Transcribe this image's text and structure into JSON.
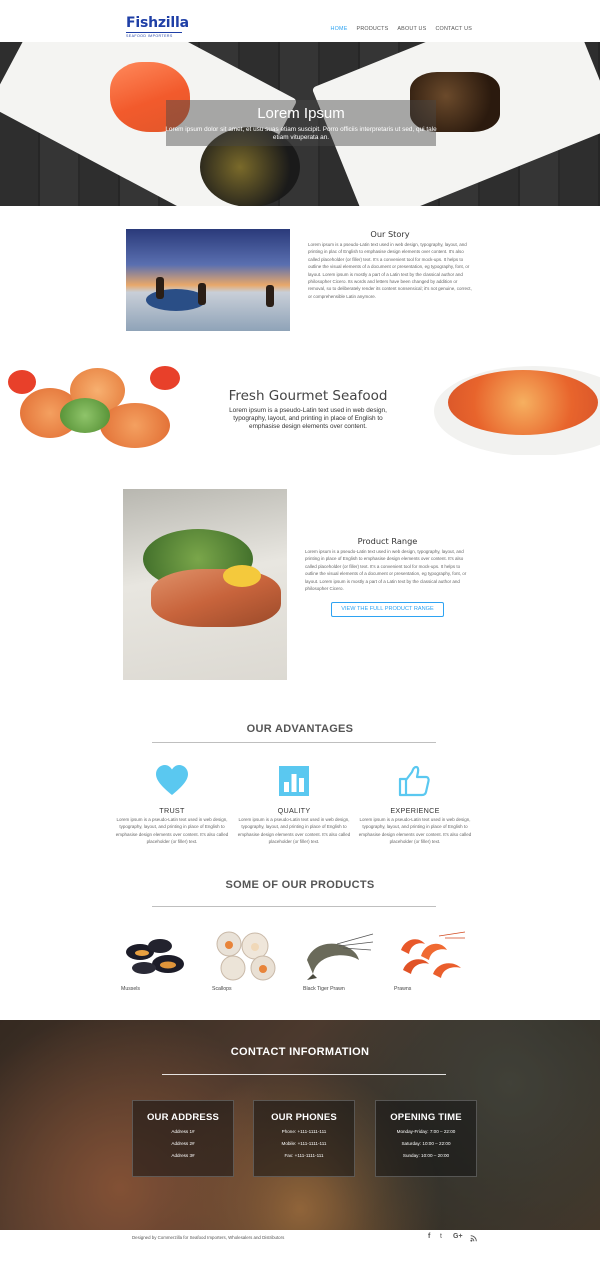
{
  "header": {
    "logo_name": "Fishzilla",
    "logo_tagline": "SEAFOOD IMPORTERS",
    "nav": [
      "HOME",
      "PRODUCTS",
      "ABOUT US",
      "CONTACT US"
    ],
    "active_nav": "HOME"
  },
  "hero": {
    "title": "Lorem Ipsum",
    "text": "Lorem ipsum dolor sit amet, et usu suas etiam suscipit. Porro officiis interpretaris ut sed, qui tale etiam vituperata an."
  },
  "story": {
    "title": "Our Story",
    "text": "Lorem ipsum is a pseudo-Latin text used in web design, typography, layout, and printing in plac of English to emphasise design elements over content. It's also called placeholder (or filler) text. It's a convenient tool for mock-ups. It helps to outline the visual elements of a document or presentation, eg typography, font, or layout. Lorem ipsum is mostly a part of a Latin text by the classical author and philosopher Cicero. Its words and letters have been changed by addition or removal, so to deliberately render its content nonsensical; it's not genuine, correct, or comprehensible Latin anymore."
  },
  "gourmet": {
    "title": "Fresh Gourmet Seafood",
    "text": "Lorem ipsum is a pseudo-Latin text used in web design, typography, layout, and printing in place of English to emphasise design elements over content."
  },
  "product_range": {
    "title": "Product Range",
    "text": "Lorem ipsum is a pseudo-Latin text used in web design, typography, layout, and printing in place of English to emphasise design elements over content. It's also called placeholder (or filler) text. It's a convenient tool for mock-ups. It helps to outline the visual elements of a document or presentation, eg typography, font, or layout. Lorem ipsum is mostly a part of a Latin text by the classical author and philosopher Cicero.",
    "button": "VIEW THE FULL PRODUCT RANGE"
  },
  "advantages": {
    "title": "OUR ADVANTAGES",
    "items": [
      {
        "icon": "heart-icon",
        "title": "TRUST",
        "text": "Lorem ipsum is a pseudo-Latin text used in web design, typography, layout, and printing in place of English to emphasise design elements over content. It's also called placeholder (or filler) text."
      },
      {
        "icon": "bar-chart-icon",
        "title": "QUALITY",
        "text": "Lorem ipsum is a pseudo-Latin text used in web design, typography, layout, and printing in place of English to emphasise design elements over content. It's also called placeholder (or filler) text."
      },
      {
        "icon": "thumbs-up-icon",
        "title": "EXPERIENCE",
        "text": "Lorem ipsum is a pseudo-Latin text used in web design, typography, layout, and printing in place of English to emphasise design elements over content. It's also called placeholder (or filler) text."
      }
    ],
    "accent": "#5ac8f0"
  },
  "products": {
    "title": "SOME OF OUR PRODUCTS",
    "items": [
      "Mussels",
      "Scallops",
      "Black Tiger Prawn",
      "Prawns"
    ]
  },
  "contact": {
    "title": "CONTACT INFORMATION",
    "address": {
      "title": "OUR ADDRESS",
      "lines": [
        "Address 1#",
        "Address 2#",
        "Address 3#"
      ]
    },
    "phones": {
      "title": "OUR PHONES",
      "lines": [
        "Phone: +111-1111-111",
        "Mobile: +111-1111-111",
        "Fax: +111-1111-111"
      ]
    },
    "hours": {
      "title": "OPENING TIME",
      "lines": [
        "Monday-Friday: 7:00 – 22:00",
        "Saturday: 10:00 – 22:00",
        "Sunday: 10:00 – 20:00"
      ]
    }
  },
  "footer": {
    "text": "Designed by Commerzilla for Seafood Importers, Wholesalers and Distributors",
    "social": [
      "f",
      "t",
      "G+",
      "rss"
    ]
  }
}
